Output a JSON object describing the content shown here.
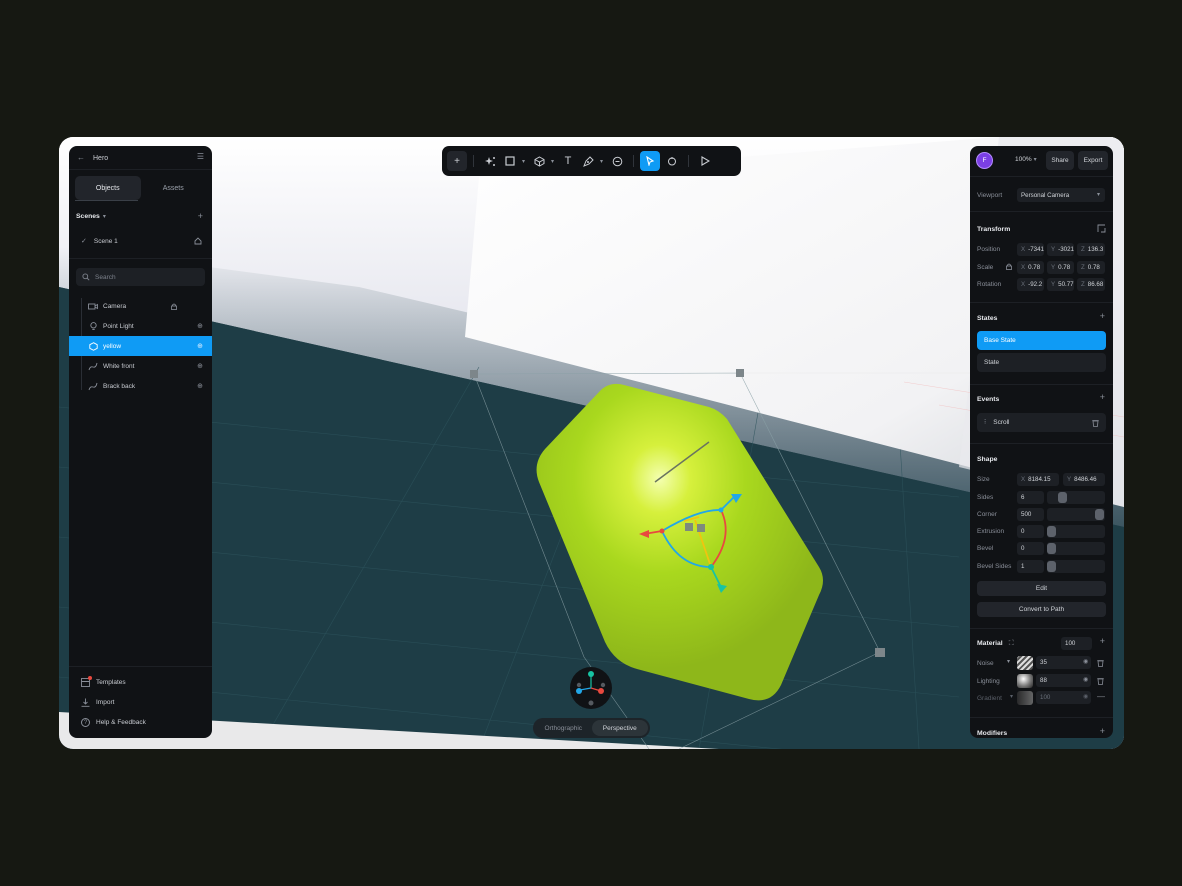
{
  "left_panel": {
    "file_name": "Hero",
    "tabs": [
      "Objects",
      "Assets"
    ],
    "scenes_label": "Scenes",
    "scene_name": "Scene 1",
    "search_placeholder": "Search",
    "layers": [
      {
        "name": "Camera",
        "icon": "camera-icon"
      },
      {
        "name": "Point Light",
        "icon": "lightbulb-icon"
      },
      {
        "name": "yellow",
        "icon": "polygon-icon",
        "selected": true
      },
      {
        "name": "White front",
        "icon": "path-icon"
      },
      {
        "name": "Brack back",
        "icon": "path-icon"
      }
    ],
    "footer": [
      "Templates",
      "Import",
      "Help & Feedback"
    ]
  },
  "toolbar": {
    "tools": [
      "add-icon",
      "ai-sparkle-icon",
      "rectangle-icon",
      "cube-icon",
      "text-icon",
      "pen-icon",
      "comment-icon",
      "select-arrow-icon",
      "hand-icon",
      "play-icon"
    ]
  },
  "right_panel": {
    "avatar_letter": "F",
    "zoom": "100%",
    "share_label": "Share",
    "export_label": "Export",
    "viewport_label": "Viewport",
    "viewport_value": "Personal Camera",
    "transform": {
      "title": "Transform",
      "position_label": "Position",
      "position": [
        "-7341",
        "-3021",
        "136.3"
      ],
      "scale_label": "Scale",
      "scale": [
        "0.78",
        "0.78",
        "0.78"
      ],
      "rotation_label": "Rotation",
      "rotation": [
        "-92.2",
        "50.77",
        "86.68"
      ]
    },
    "states": {
      "title": "States",
      "items": [
        "Base State",
        "State"
      ]
    },
    "events": {
      "title": "Events",
      "items": [
        "Scroll"
      ]
    },
    "shape": {
      "title": "Shape",
      "size_label": "Size",
      "size": [
        "8184.15",
        "8486.46"
      ],
      "sides_label": "Sides",
      "sides": "6",
      "sides_fraction": 0.2,
      "corner_label": "Corner",
      "corner": "500",
      "corner_fraction": 1.0,
      "extrusion_label": "Extrusion",
      "extrusion": "0",
      "bevel_label": "Bevel",
      "bevel": "0",
      "bevel_sides_label": "Bevel Sides",
      "bevel_sides": "1",
      "edit_label": "Edit",
      "convert_label": "Convert to Path"
    },
    "material": {
      "title": "Material",
      "opacity": "100",
      "layers": [
        {
          "name": "Noise",
          "value": "35"
        },
        {
          "name": "Lighting",
          "value": "88"
        },
        {
          "name": "Gradient",
          "value": "100"
        }
      ]
    },
    "modifiers_title": "Modifiers"
  },
  "view_toggle": [
    "Orthographic",
    "Perspective"
  ],
  "axes": [
    "X",
    "Y",
    "Z"
  ],
  "colors": {
    "accent": "#0f9bf5",
    "panel": "#101215",
    "shape_green": "#a9d81e"
  }
}
